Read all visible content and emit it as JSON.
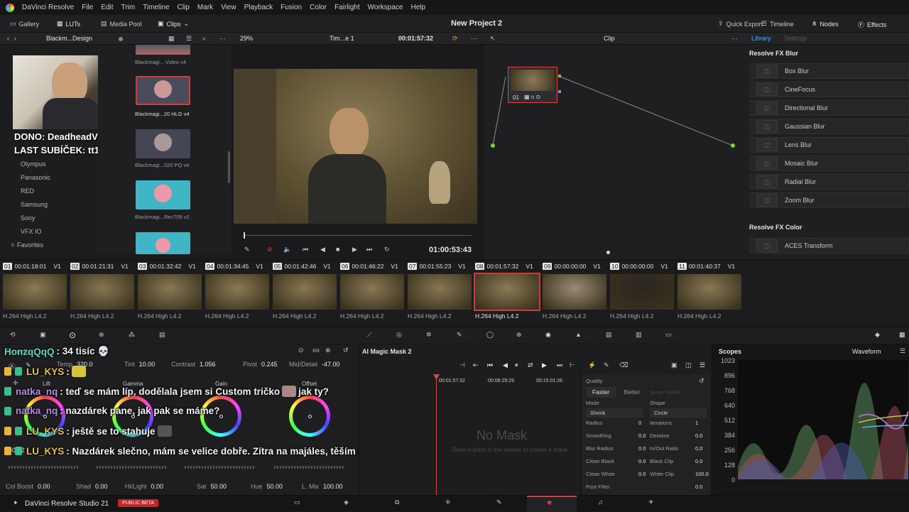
{
  "menubar": {
    "app": "DaVinci Resolve",
    "items": [
      "File",
      "Edit",
      "Trim",
      "Timeline",
      "Clip",
      "Mark",
      "View",
      "Playback",
      "Fusion",
      "Color",
      "Fairlight",
      "Workspace",
      "Help"
    ]
  },
  "toolbar": {
    "gallery": "Gallery",
    "luts": "LUTs",
    "media_pool": "Media Pool",
    "clips": "Clips",
    "project": "New Project 2",
    "quick_export": "Quick Export",
    "timeline": "Timeline",
    "nodes": "Nodes",
    "effects": "Effects"
  },
  "panelhdr": {
    "lut_folder": "Blackm...Design",
    "zoom": "29%",
    "timeline_name": "Tim...e 1",
    "timecode": "00:01:57:32",
    "clip_mode": "Clip",
    "library_tab": "Library",
    "settings_tab": "Settings"
  },
  "lut_list": [
    "Olympus",
    "Panasonic",
    "RED",
    "Samsung",
    "Sony",
    "VFX IO",
    "Favorites"
  ],
  "overlay": {
    "dono": "DONO: DeadheadVinc - Kč9",
    "sub": "LAST SUBÍČEK: tt1209_"
  },
  "luts": [
    "Blackmagi... Video v4",
    "Blackmagi...20 HLG v4",
    "Blackmagi...020 PQ v4",
    "Blackmagi...Rec709 v2"
  ],
  "viewer": {
    "timecode": "01:00:53:43"
  },
  "node": {
    "label": "01"
  },
  "fx": {
    "blur_header": "Resolve FX Blur",
    "blur_items": [
      "Box Blur",
      "CineFocus",
      "Directional Blur",
      "Gaussian Blur",
      "Lens Blur",
      "Mosaic Blur",
      "Radial Blur",
      "Zoom Blur"
    ],
    "color_header": "Resolve FX Color",
    "color_items": [
      "ACES Transform"
    ]
  },
  "clips": [
    {
      "num": "01",
      "tc": "00:01:18:01",
      "track": "V1",
      "codec": "H.264 High L4.2"
    },
    {
      "num": "02",
      "tc": "00:01:21:31",
      "track": "V1",
      "codec": "H.264 High L4.2"
    },
    {
      "num": "03",
      "tc": "00:01:32:42",
      "track": "V1",
      "codec": "H.264 High L4.2"
    },
    {
      "num": "04",
      "tc": "00:01:34:45",
      "track": "V1",
      "codec": "H.264 High L4.2"
    },
    {
      "num": "05",
      "tc": "00:01:42:46",
      "track": "V1",
      "codec": "H.264 High L4.2"
    },
    {
      "num": "06",
      "tc": "00:01:46:22",
      "track": "V1",
      "codec": "H.264 High L4.2"
    },
    {
      "num": "07",
      "tc": "00:01:55:23",
      "track": "V1",
      "codec": "H.264 High L4.2"
    },
    {
      "num": "08",
      "tc": "00:01:57:32",
      "track": "V1",
      "codec": "H.264 High L4.2"
    },
    {
      "num": "09",
      "tc": "00:00:00:00",
      "track": "V1",
      "codec": "H.264 High L4.2"
    },
    {
      "num": "10",
      "tc": "00:00:00:00",
      "track": "V1",
      "codec": "H.264 High L4.2"
    },
    {
      "num": "11",
      "tc": "00:01:40:37",
      "track": "V1",
      "codec": "H.264 High L4.2"
    }
  ],
  "color": {
    "primaries": "Primaries",
    "temp_label": "Temp",
    "temp": "320.0",
    "tint_label": "Tint",
    "tint": "10.00",
    "contrast_label": "Contrast",
    "contrast": "1.056",
    "pivot_label": "Pivot",
    "pivot": "0.245",
    "middetail_label": "Mid/Detail",
    "middetail": "-47.00",
    "lift": "Lift",
    "gamma": "Gamma",
    "gain": "Gain",
    "offset": "Offset",
    "lift_val": "-0.12",
    "colboost_label": "Col Boost",
    "colboost": "0.00",
    "shad_label": "Shad",
    "shad": "0.00",
    "hilight_label": "Hi/Light",
    "hilight": "0.00",
    "sat_label": "Sat",
    "sat": "50.00",
    "hue_label": "Hue",
    "hue": "50.00",
    "lmix_label": "L. Mix",
    "lmix": "100.00"
  },
  "mask": {
    "title": "AI Magic Mask 2",
    "tc1": "00:01:57:32",
    "tc2": "00:08:29:29",
    "tc3": "00:15:01:26",
    "no_mask": "No Mask",
    "hint": "Draw a point in the viewer to create a mask."
  },
  "quality": {
    "title": "Quality",
    "faster": "Faster",
    "better": "Better",
    "smart_refine": "Smart Refine",
    "mode": "Mode",
    "mode_val": "Shrink",
    "shape": "Shape",
    "shape_val": "Circle",
    "rows": [
      {
        "l": "Radius",
        "v": "0",
        "r": "Iterations",
        "rv": "1"
      },
      {
        "l": "Smoothing",
        "v": "0.0",
        "r": "Denoise",
        "rv": "0.0"
      },
      {
        "l": "Blur Radius",
        "v": "0.0",
        "r": "In/Out Ratio",
        "rv": "0.0"
      },
      {
        "l": "Clean Black",
        "v": "0.0",
        "r": "Black Clip",
        "rv": "0.0"
      },
      {
        "l": "Clean White",
        "v": "0.0",
        "r": "White Clip",
        "rv": "100.0"
      },
      {
        "l": "Post Filter",
        "v": "",
        "r": "",
        "rv": "0.0"
      }
    ]
  },
  "scopes": {
    "title": "Scopes",
    "mode": "Waveform",
    "scale": [
      "1023",
      "896",
      "768",
      "640",
      "512",
      "384",
      "256",
      "128",
      "0"
    ]
  },
  "bottom": {
    "app": "DaVinci Resolve Studio 21",
    "beta": "PUBLIC BETA"
  },
  "chat": [
    {
      "user": "HonzqQqQ",
      "msg": ": 34 tisíc 💀"
    },
    {
      "user": "LU_KYS",
      "msg": ":"
    },
    {
      "user": "natka_nq",
      "msg": ": teď se mám líp, dodělala jsem si Custom tričko",
      "after": "jak ty?"
    },
    {
      "user": "natka_nq",
      "msg": ": nazdárek pane, jak pak se máme?"
    },
    {
      "user": "LU_KYS",
      "msg": ": ještě se to stahuje"
    },
    {
      "user": "LU_KYS",
      "msg": ": Nazdárek slečno, mám se velice dobře. Zítra na majáles, těším se"
    }
  ],
  "colors": {
    "accent": "#e04040",
    "link": "#4ea6ff",
    "bg": "#1b1b1d"
  }
}
